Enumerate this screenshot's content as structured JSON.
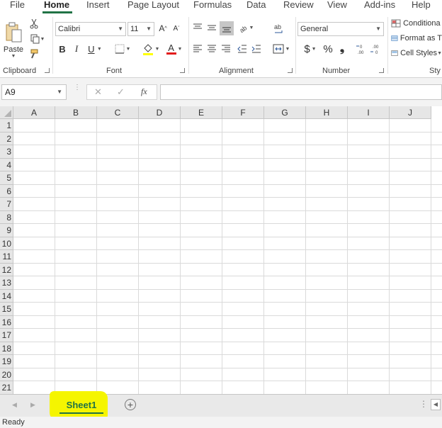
{
  "menu": {
    "tabs": [
      "File",
      "Home",
      "Insert",
      "Page Layout",
      "Formulas",
      "Data",
      "Review",
      "View",
      "Add-ins",
      "Help"
    ],
    "active": "Home"
  },
  "ribbon": {
    "clipboard": {
      "label": "Clipboard",
      "paste": "Paste"
    },
    "font": {
      "label": "Font",
      "name": "Calibri",
      "size": "11",
      "bold": "B",
      "italic": "I",
      "underline": "U",
      "grow": "A",
      "shrink": "A",
      "font_color_glyph": "A"
    },
    "alignment": {
      "label": "Alignment"
    },
    "number": {
      "label": "Number",
      "format": "General",
      "currency": "$",
      "percent": "%",
      "comma": ")"
    },
    "styles": {
      "label": "Sty",
      "conditional": "Conditiona",
      "format_as": "Format as T",
      "cell_styles": "Cell Styles"
    }
  },
  "formula_bar": {
    "name_box": "A9",
    "fx": "fx",
    "cancel": "✕",
    "enter": "✓",
    "value": ""
  },
  "grid": {
    "columns": [
      "A",
      "B",
      "C",
      "D",
      "E",
      "F",
      "G",
      "H",
      "I",
      "J"
    ],
    "rows": [
      "1",
      "2",
      "3",
      "4",
      "5",
      "6",
      "7",
      "8",
      "9",
      "10",
      "11",
      "12",
      "13",
      "14",
      "15",
      "16",
      "17",
      "18",
      "19",
      "20",
      "21"
    ]
  },
  "sheets": {
    "active": "Sheet1",
    "add_label": "+"
  },
  "status": {
    "text": "Ready"
  },
  "colors": {
    "accent": "#217346",
    "highlight": "#f5f500",
    "font_color_bar": "#e31c1c",
    "highlight_bar": "#ffff00"
  }
}
